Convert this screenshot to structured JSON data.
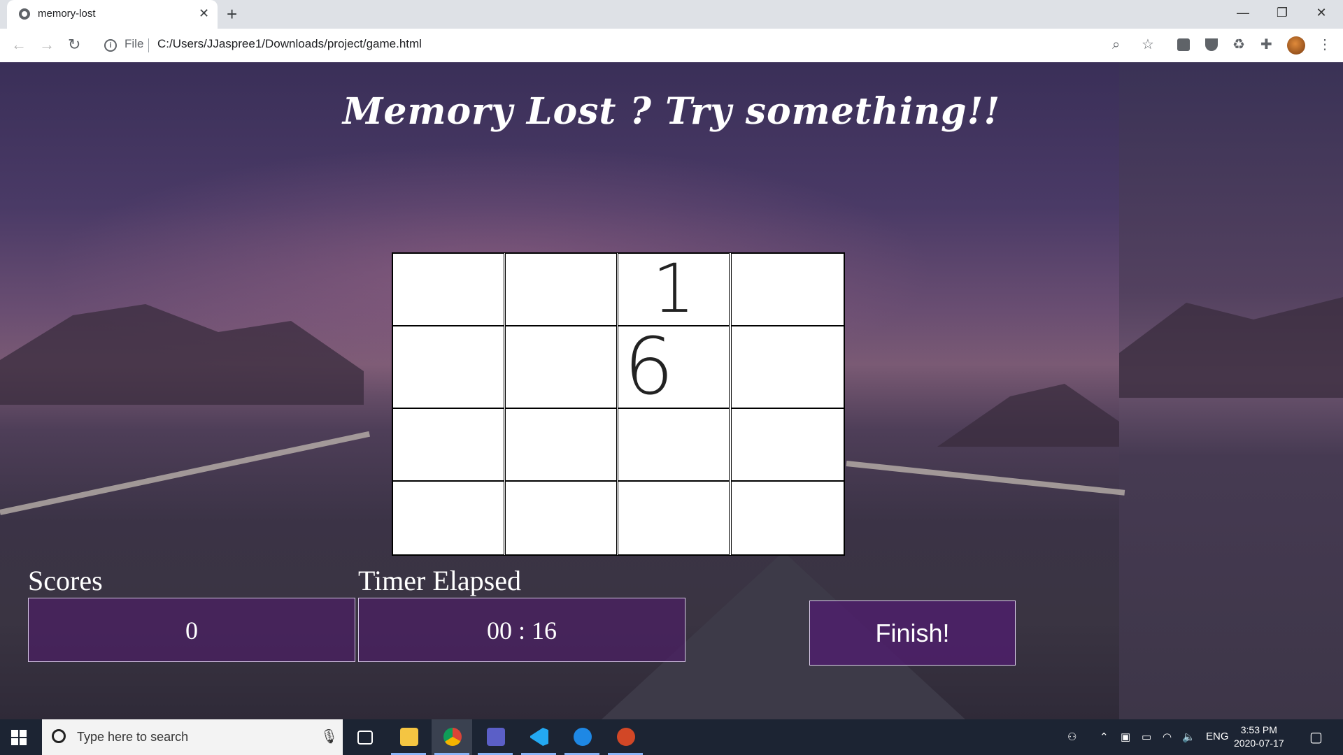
{
  "browser": {
    "tab_title": "memory-lost",
    "tab_close": "✕",
    "new_tab": "+",
    "window_controls": {
      "minimize": "—",
      "maximize": "❐",
      "close": "✕"
    },
    "nav": {
      "back": "←",
      "forward": "→",
      "reload": "↻"
    },
    "address": {
      "info": "i",
      "scheme": "File",
      "url": "C:/Users/JJaspree1/Downloads/project/game.html"
    },
    "toolbar_icons": [
      "zoom-icon",
      "star-icon",
      "extension-icon",
      "shield-icon",
      "recycle-icon",
      "puzzle-icon",
      "profile-avatar",
      "menu-icon"
    ],
    "menu": "⋮"
  },
  "page": {
    "title": "Memory Lost ? Try something!!",
    "board": {
      "rows": [
        [
          "",
          "",
          "1",
          ""
        ],
        [
          "",
          "",
          "6",
          ""
        ],
        [
          "",
          "",
          "",
          ""
        ],
        [
          "",
          "",
          "",
          ""
        ]
      ]
    },
    "scores_label": "Scores",
    "scores_value": "0",
    "timer_label": "Timer Elapsed",
    "timer_value": "00 : 16",
    "finish_label": "Finish!"
  },
  "taskbar": {
    "search_placeholder": "Type here to search",
    "apps": [
      "task-view",
      "file-explorer",
      "chrome",
      "teams",
      "vscode",
      "edge",
      "powerpoint"
    ],
    "tray_lang": "ENG",
    "time": "3:53 PM",
    "date": "2020-07-17"
  },
  "colors": {
    "button_fill": "#4b1e64",
    "page_tint": "#3a2f58"
  }
}
